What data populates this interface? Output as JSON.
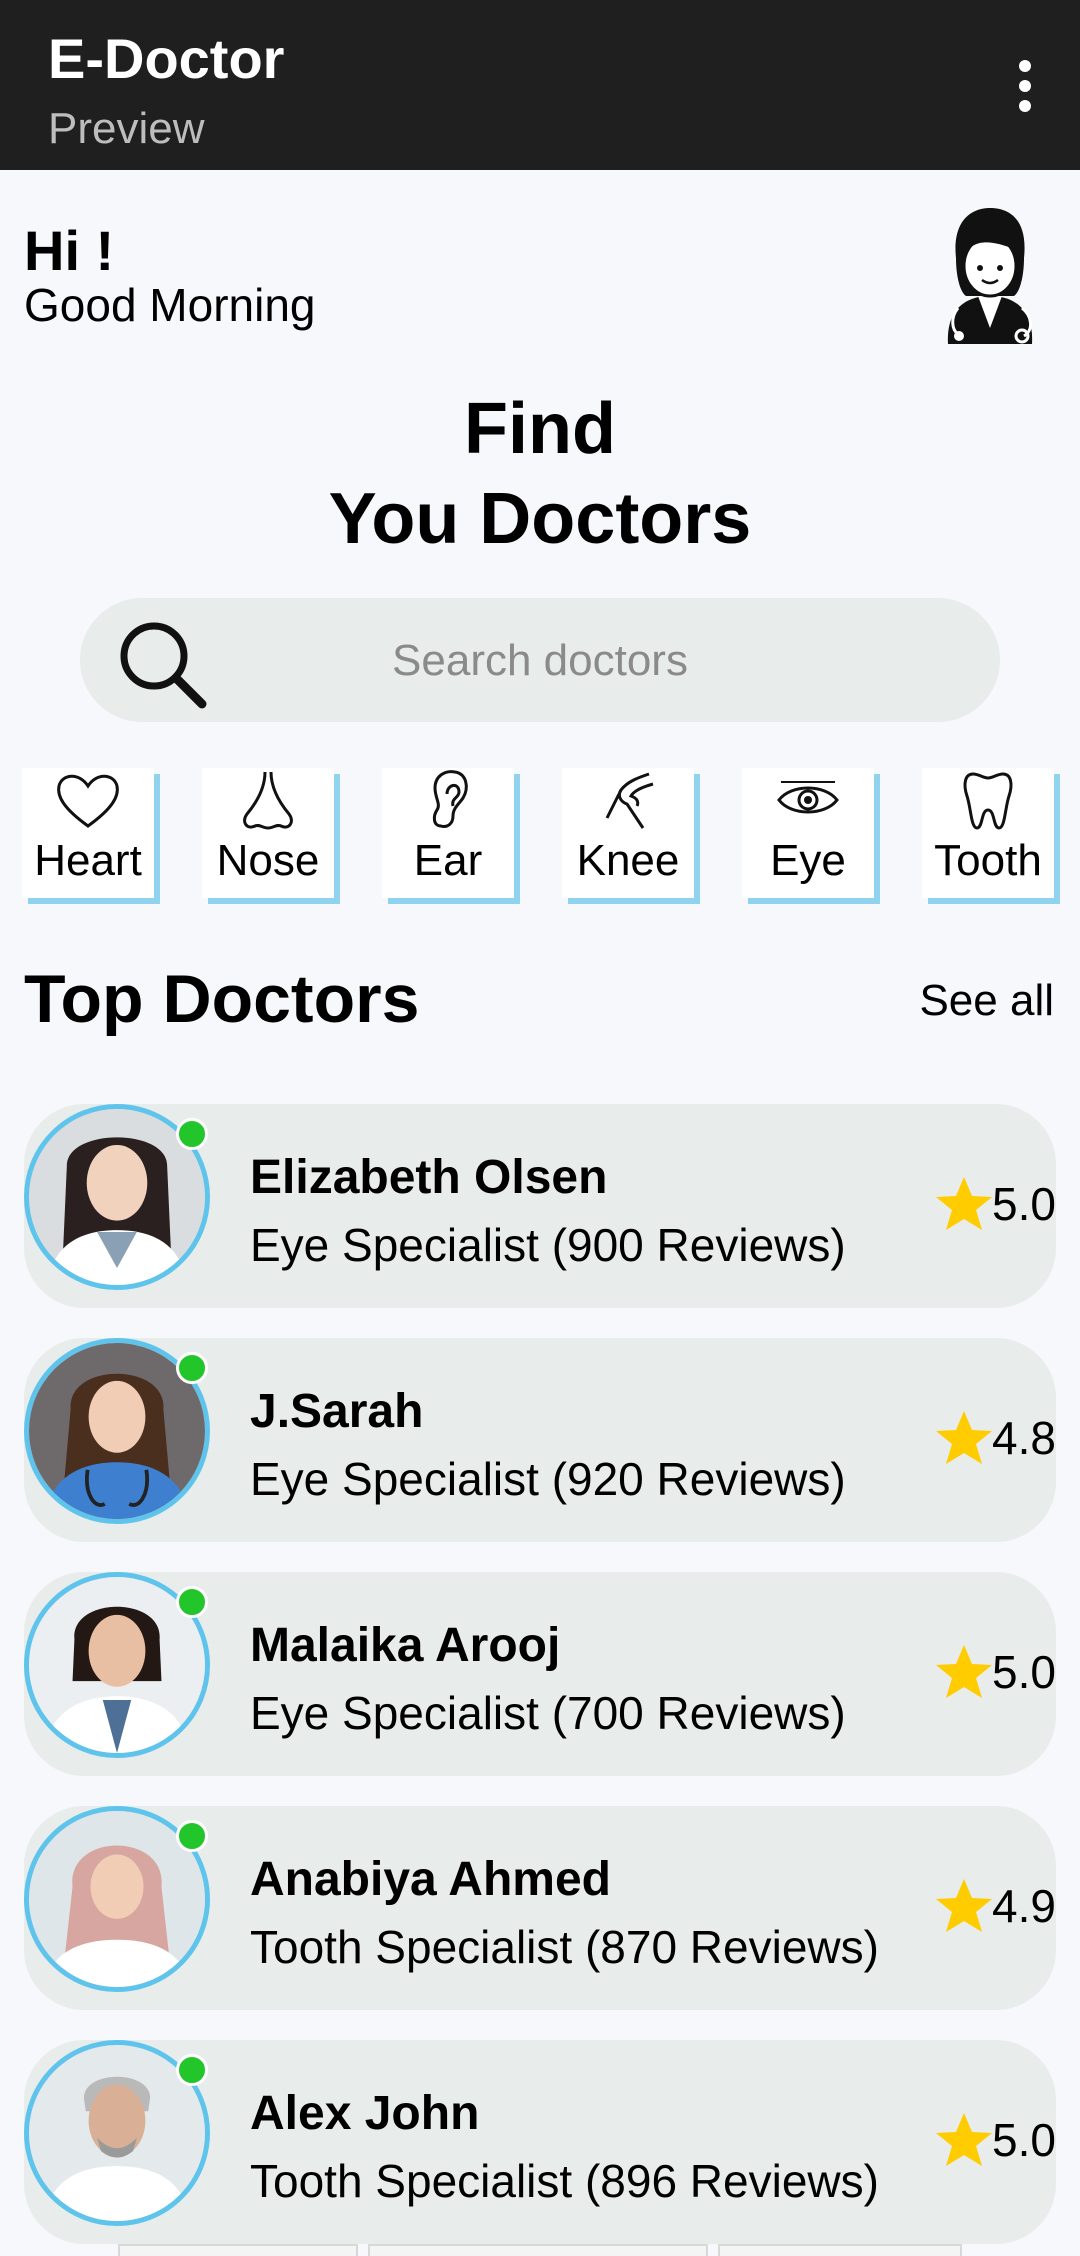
{
  "app": {
    "title": "E-Doctor",
    "subtitle": "Preview"
  },
  "greeting": {
    "hi": "Hi !",
    "sub": "Good Morning"
  },
  "hero": {
    "line1": "Find",
    "line2": "You Doctors"
  },
  "search": {
    "placeholder": "Search doctors"
  },
  "categories": [
    {
      "label": "Heart",
      "icon": "heart-icon"
    },
    {
      "label": "Nose",
      "icon": "nose-icon"
    },
    {
      "label": "Ear",
      "icon": "ear-icon"
    },
    {
      "label": "Knee",
      "icon": "knee-icon"
    },
    {
      "label": "Eye",
      "icon": "eye-icon"
    },
    {
      "label": "Tooth",
      "icon": "tooth-icon"
    }
  ],
  "top_doctors": {
    "title": "Top Doctors",
    "see_all": "See all",
    "items": [
      {
        "name": "Elizabeth Olsen",
        "specialty": "Eye Specialist (900 Reviews)",
        "rating": "5.0",
        "online": true
      },
      {
        "name": "J.Sarah",
        "specialty": "Eye Specialist (920 Reviews)",
        "rating": "4.8",
        "online": true
      },
      {
        "name": "Malaika Arooj",
        "specialty": "Eye Specialist (700 Reviews)",
        "rating": "5.0",
        "online": true
      },
      {
        "name": "Anabiya Ahmed",
        "specialty": "Tooth Specialist (870 Reviews)",
        "rating": "4.9",
        "online": true
      },
      {
        "name": "Alex John",
        "specialty": "Tooth Specialist (896 Reviews)",
        "rating": "5.0",
        "online": true
      }
    ]
  },
  "colors": {
    "appbar": "#1f1f1f",
    "background": "#f6f8fc",
    "card": "#e8eceb",
    "accent": "#5ec4ec",
    "online": "#22c52a",
    "star": "#ffcc00"
  }
}
